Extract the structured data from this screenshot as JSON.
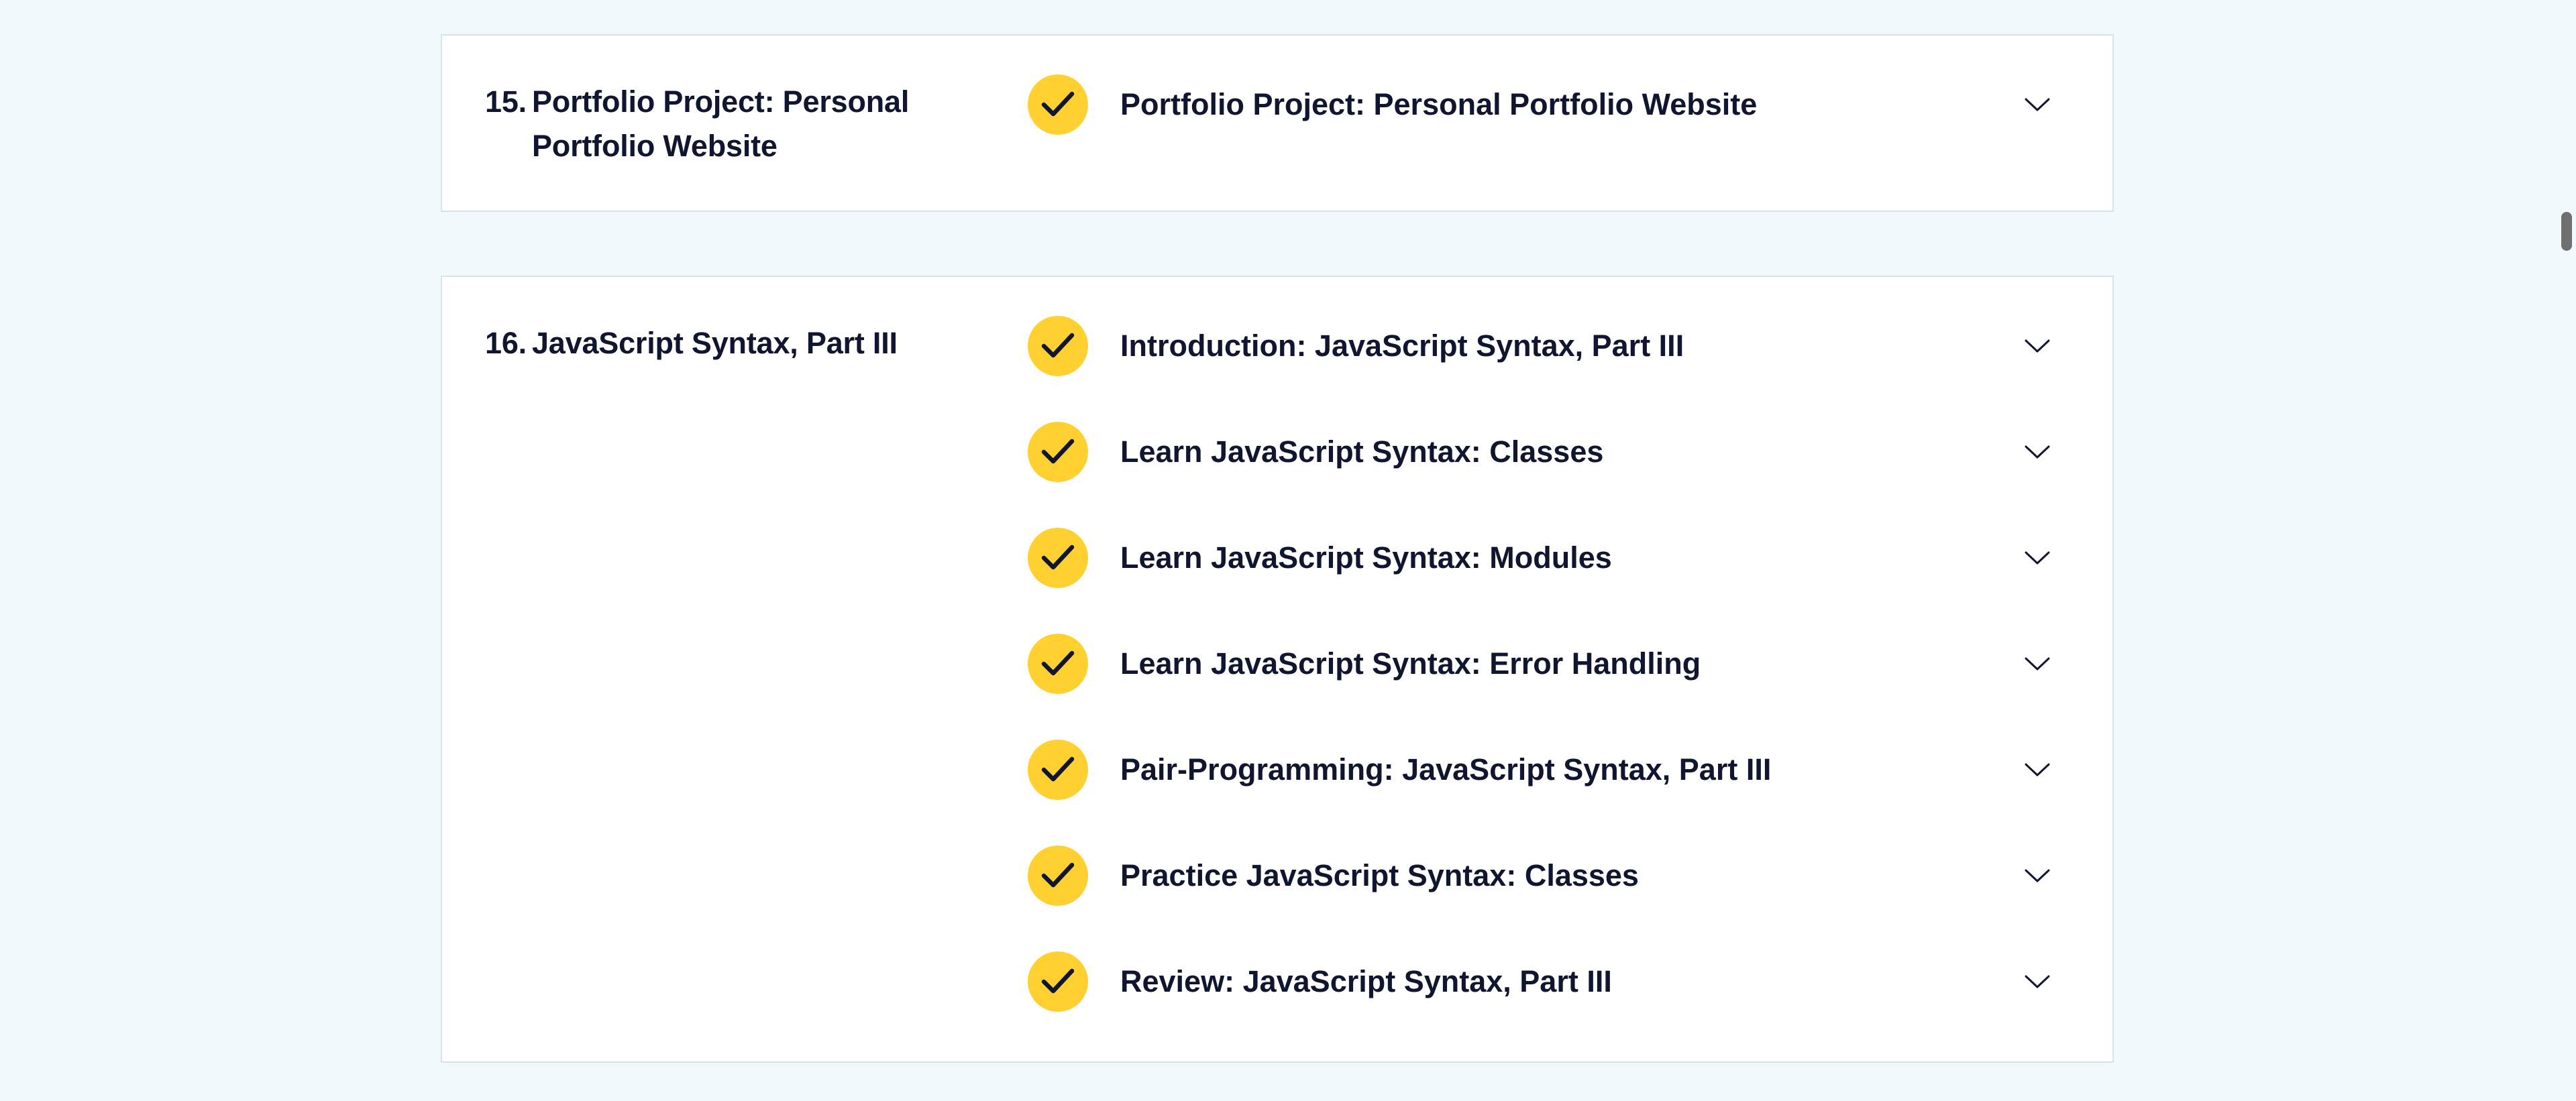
{
  "modules": [
    {
      "number": "15.",
      "title": "Portfolio Project: Personal Portfolio Website",
      "lessons": [
        {
          "title": "Portfolio Project: Personal Portfolio Website",
          "completed": true
        }
      ]
    },
    {
      "number": "16.",
      "title": "JavaScript Syntax, Part III",
      "lessons": [
        {
          "title": "Introduction: JavaScript Syntax, Part III",
          "completed": true
        },
        {
          "title": "Learn JavaScript Syntax: Classes",
          "completed": true
        },
        {
          "title": "Learn JavaScript Syntax: Modules",
          "completed": true
        },
        {
          "title": "Learn JavaScript Syntax: Error Handling",
          "completed": true
        },
        {
          "title": "Pair-Programming: JavaScript Syntax, Part III",
          "completed": true
        },
        {
          "title": "Practice JavaScript Syntax: Classes",
          "completed": true
        },
        {
          "title": "Review: JavaScript Syntax, Part III",
          "completed": true
        }
      ]
    }
  ],
  "icons": {
    "completed": "check-icon",
    "expand": "chevron-down-icon"
  },
  "colors": {
    "page_background": "#f2f9fd",
    "card_background": "#ffffff",
    "card_border": "#d7e3ea",
    "check_badge": "#ffd02f",
    "text": "#10162f"
  }
}
